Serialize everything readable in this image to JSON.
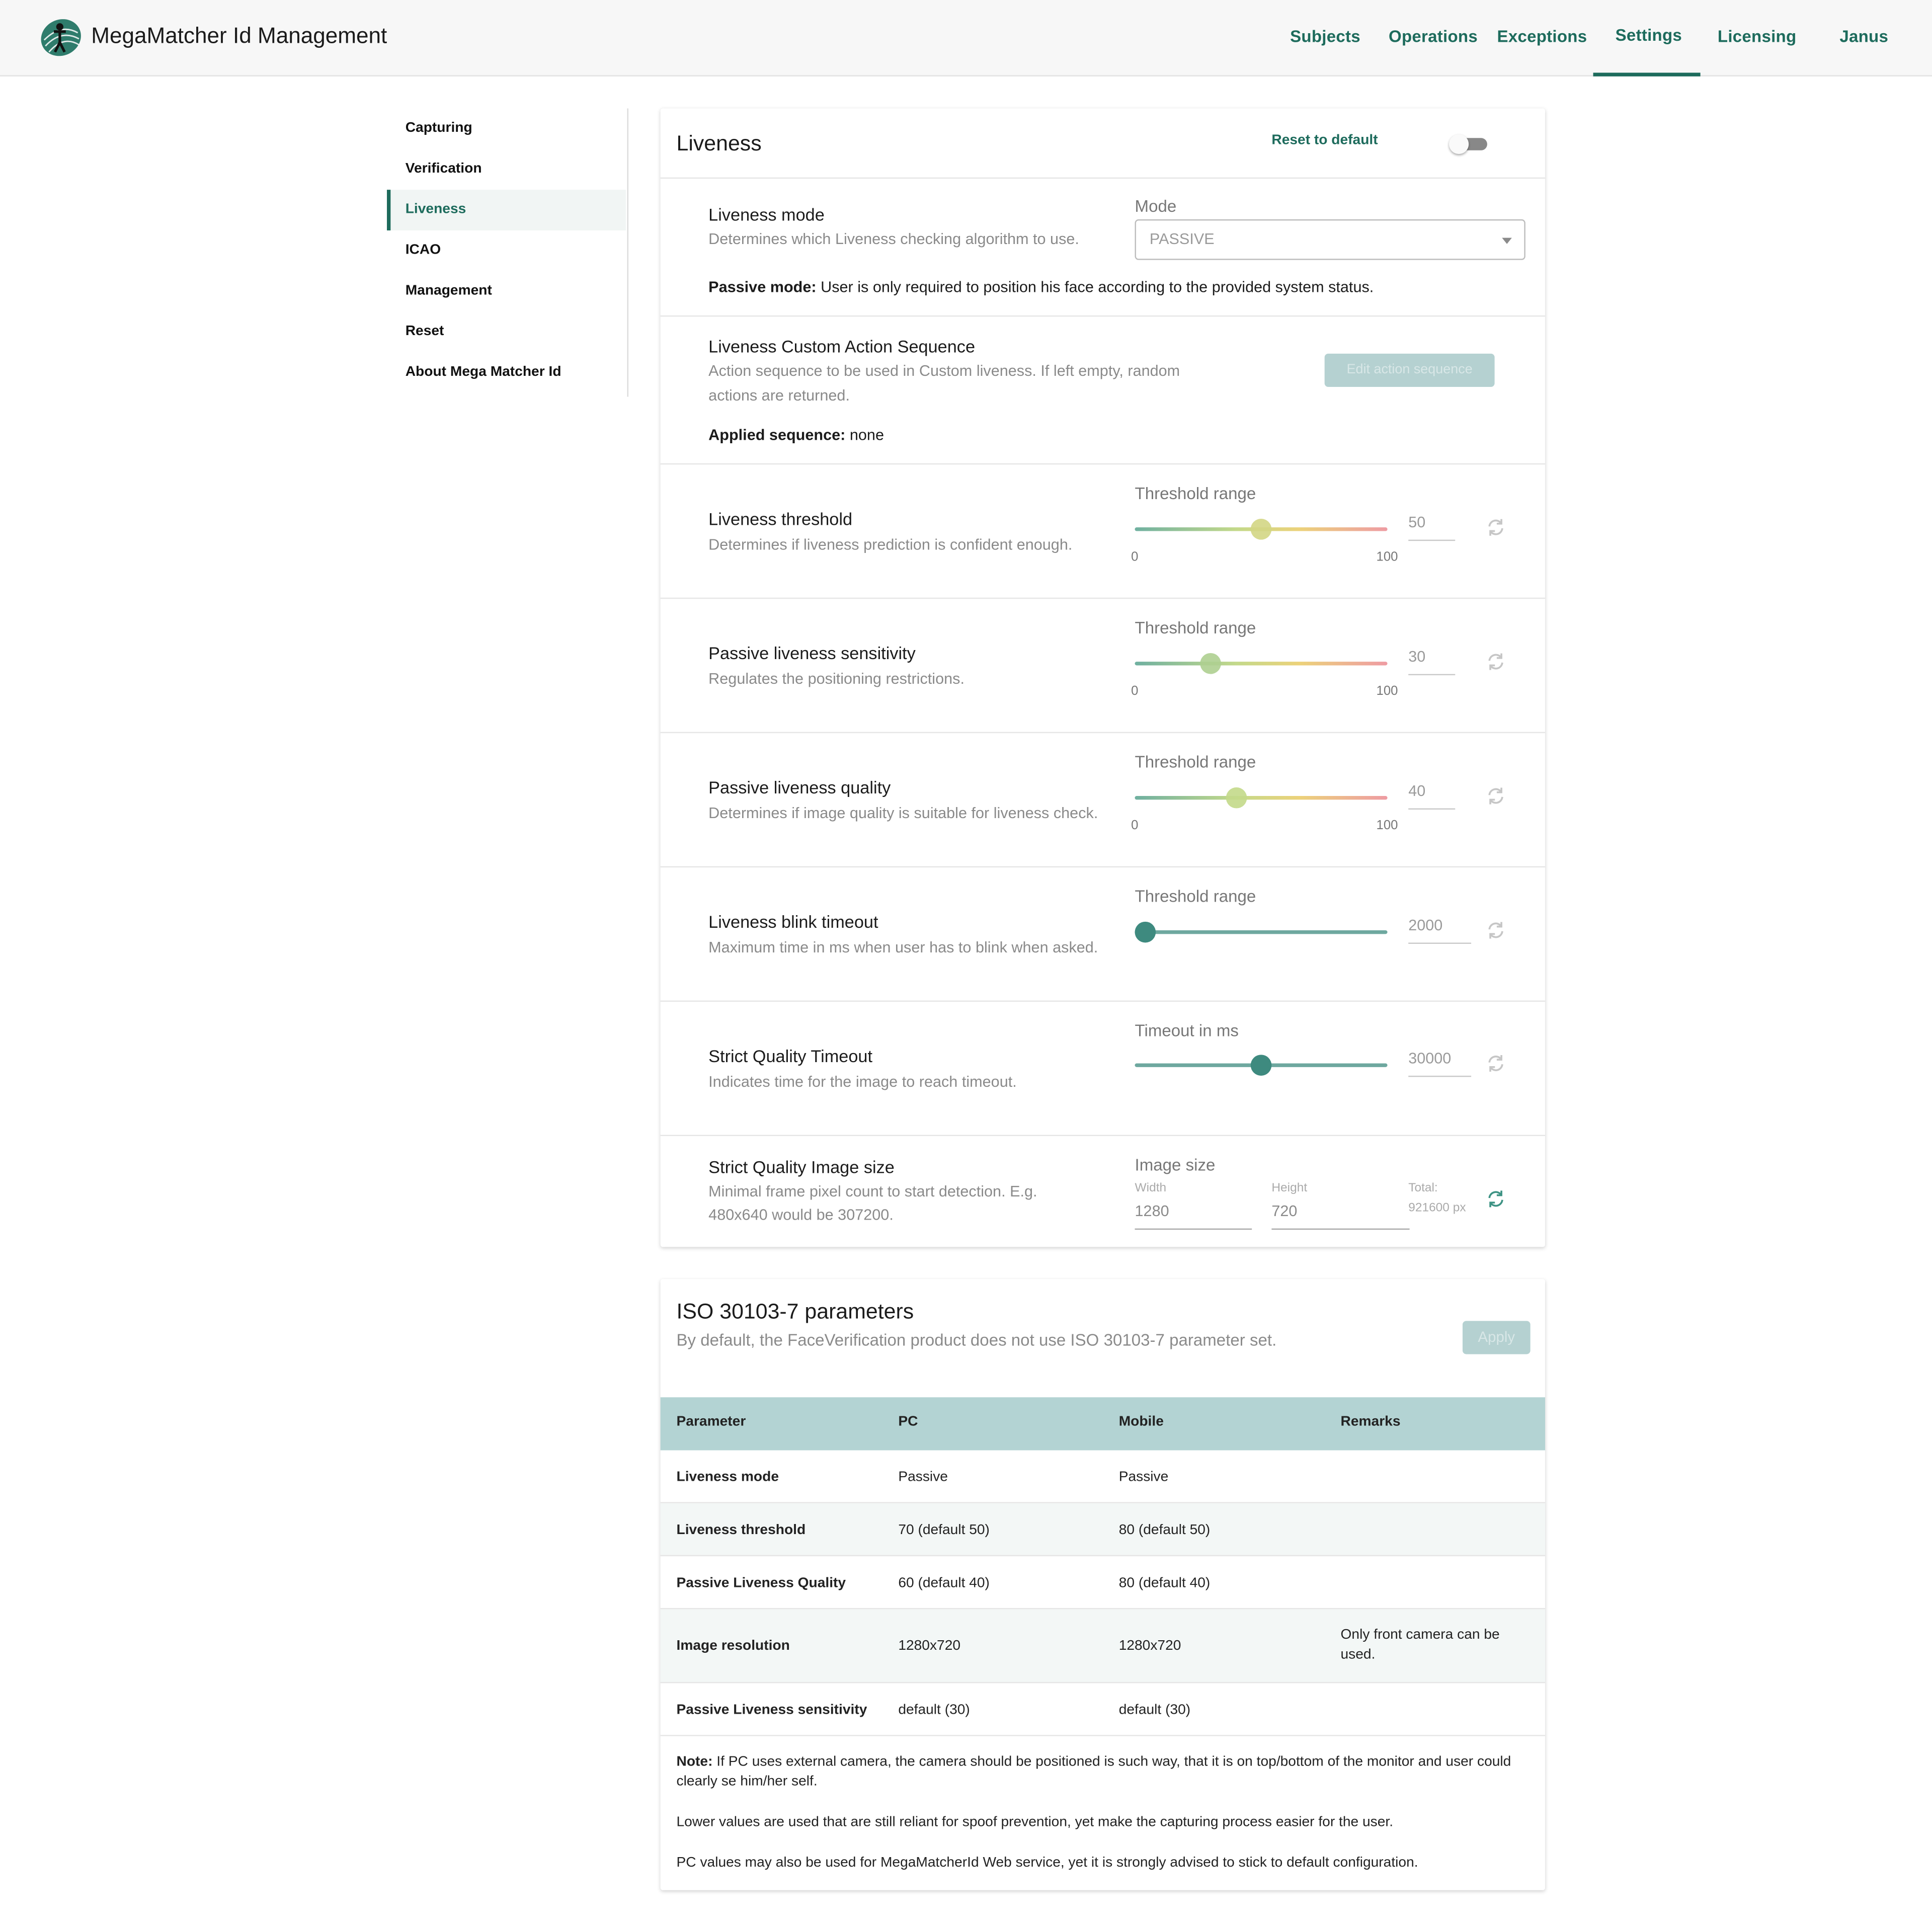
{
  "header": {
    "app_title": "MegaMatcher Id Management",
    "nav": [
      {
        "label": "Subjects"
      },
      {
        "label": "Operations"
      },
      {
        "label": "Exceptions"
      },
      {
        "label": "Settings",
        "active": true
      },
      {
        "label": "Licensing"
      },
      {
        "label": "Janus"
      }
    ],
    "accent_color": "#1d6b5c"
  },
  "sidebar": {
    "items": [
      {
        "label": "Capturing"
      },
      {
        "label": "Verification"
      },
      {
        "label": "Liveness",
        "active": true
      },
      {
        "label": "ICAO"
      },
      {
        "label": "Management"
      },
      {
        "label": "Reset"
      },
      {
        "label": "About Mega Matcher Id"
      }
    ]
  },
  "liveness": {
    "title": "Liveness",
    "reset_label": "Reset to default",
    "reset_toggle_on": false,
    "mode": {
      "title": "Liveness mode",
      "desc": "Determines which Liveness checking algorithm to use.",
      "field_label": "Mode",
      "value": "PASSIVE",
      "note_bold": "Passive mode:",
      "note_text": " User is only required to position his face according to the provided system status."
    },
    "sequence": {
      "title": "Liveness Custom Action Sequence",
      "desc_line1": "Action sequence to be used in Custom liveness. If left empty, random",
      "desc_line2": "actions are returned.",
      "button": "Edit action sequence",
      "applied_bold": "Applied sequence:",
      "applied_value": " none"
    },
    "threshold": {
      "title": "Liveness threshold",
      "desc": "Determines if liveness prediction is confident enough.",
      "field_label": "Threshold range",
      "min": "0",
      "max": "100",
      "value": "50",
      "fraction": 0.5
    },
    "sensitivity": {
      "title": "Passive liveness sensitivity",
      "desc": "Regulates the positioning restrictions.",
      "field_label": "Threshold range",
      "min": "0",
      "max": "100",
      "value": "30",
      "fraction": 0.3
    },
    "quality": {
      "title": "Passive liveness quality",
      "desc": "Determines if image quality is suitable for liveness check.",
      "field_label": "Threshold range",
      "min": "0",
      "max": "100",
      "value": "40",
      "fraction": 0.4
    },
    "blink": {
      "title": "Liveness blink timeout",
      "desc": "Maximum time in ms when user has to blink when asked.",
      "field_label": "Threshold range",
      "value": "2000",
      "fraction": 0.0
    },
    "strict_timeout": {
      "title": "Strict Quality Timeout",
      "desc": "Indicates time for the image to reach timeout.",
      "field_label": "Timeout in ms",
      "value": "30000",
      "fraction": 0.5
    },
    "image_size": {
      "title": "Strict Quality Image size",
      "desc_line1": "Minimal frame pixel count to start detection. E.g.",
      "desc_line2": "480x640 would be 307200.",
      "field_label": "Image size",
      "width_label": "Width",
      "width_value": "1280",
      "height_label": "Height",
      "height_value": "720",
      "total_label": "Total:",
      "total_value": "921600 px"
    }
  },
  "iso": {
    "title": "ISO 30103-7 parameters",
    "desc": "By default, the FaceVerification product does not use ISO 30103-7 parameter set.",
    "apply_label": "Apply",
    "columns": [
      "Parameter",
      "PC",
      "Mobile",
      "Remarks"
    ],
    "rows": [
      {
        "param": "Liveness mode",
        "pc": "Passive",
        "mobile": "Passive",
        "remarks": ""
      },
      {
        "param": "Liveness threshold",
        "pc": "70 (default 50)",
        "mobile": "80 (default 50)",
        "remarks": ""
      },
      {
        "param": "Passive Liveness Quality",
        "pc": "60 (default 40)",
        "mobile": "80 (default 40)",
        "remarks": ""
      },
      {
        "param": "Image resolution",
        "pc": "1280x720",
        "mobile": "1280x720",
        "remarks": "Only front camera can be used."
      },
      {
        "param": "Passive Liveness sensitivity",
        "pc": "default (30)",
        "mobile": "default (30)",
        "remarks": ""
      }
    ],
    "note_bold": "Note:",
    "note_text": " If PC uses external camera, the camera should be positioned is such way, that it is on top/bottom of the monitor and user could clearly se him/her self.",
    "note2": "Lower values are used that are still reliant for spoof prevention, yet make the capturing process easier for the user.",
    "note3": "PC values may also be used for MegaMatcherId Web service, yet it is strongly advised to stick to default configuration."
  }
}
